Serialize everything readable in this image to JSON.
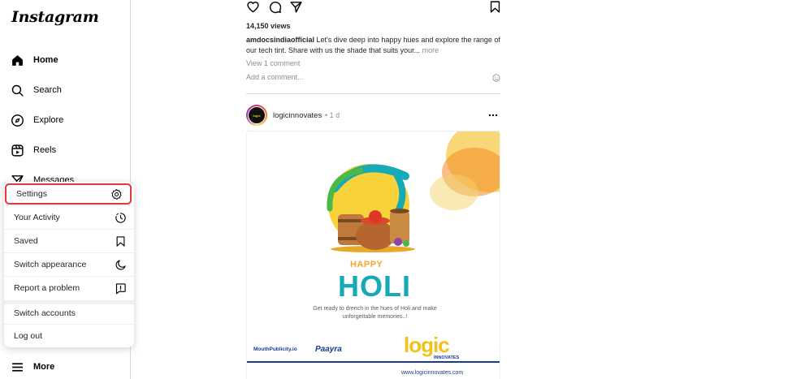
{
  "sidebar": {
    "logo": "Instagram",
    "items": [
      {
        "label": "Home",
        "icon": "home-icon"
      },
      {
        "label": "Search",
        "icon": "search-icon"
      },
      {
        "label": "Explore",
        "icon": "compass-icon"
      },
      {
        "label": "Reels",
        "icon": "reels-icon"
      },
      {
        "label": "Messages",
        "icon": "send-icon"
      },
      {
        "label": "More",
        "icon": "hamburger-icon"
      }
    ]
  },
  "menu": {
    "items": [
      {
        "label": "Settings",
        "icon": "gear-icon"
      },
      {
        "label": "Your Activity",
        "icon": "activity-icon"
      },
      {
        "label": "Saved",
        "icon": "bookmark-icon"
      },
      {
        "label": "Switch appearance",
        "icon": "moon-icon"
      },
      {
        "label": "Report a problem",
        "icon": "report-icon"
      },
      {
        "label": "Switch accounts"
      },
      {
        "label": "Log out"
      }
    ],
    "highlight_color": "#e0363d"
  },
  "post1": {
    "views": "14,150 views",
    "username": "amdocsindiaofficial",
    "caption": "Let's dive deep into happy hues and explore the range of our tech tint. Share with us the shade that suits your...",
    "more": "more",
    "view_comments": "View 1 comment",
    "add_comment": "Add a comment..."
  },
  "post2": {
    "username": "logicinnovates",
    "time": "• 1 d",
    "avatar_text": "logic",
    "image": {
      "happy": "HAPPY",
      "holi": "HOLI",
      "tagline": "Get ready to drench in the hues of Holi and make unforgettable memories..!",
      "brand1": "MouthPublicity.io",
      "brand2": "Paayra",
      "logo": "logic",
      "logo_sub": "INNOVATES",
      "website": "www.logicinnovates.com"
    }
  }
}
